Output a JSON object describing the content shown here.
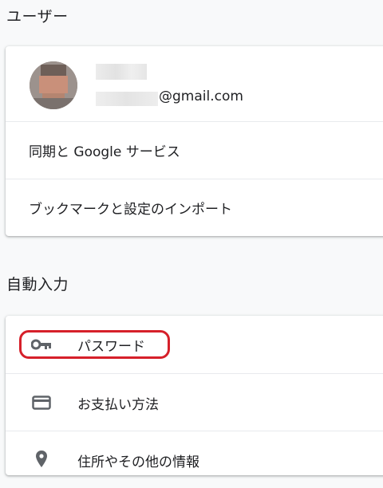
{
  "sections": {
    "user": {
      "title": "ユーザー",
      "account": {
        "email_suffix": "@gmail.com"
      },
      "rows": [
        {
          "label": "同期と Google サービス"
        },
        {
          "label": "ブックマークと設定のインポート"
        }
      ]
    },
    "autofill": {
      "title": "自動入力",
      "rows": [
        {
          "label": "パスワード",
          "icon": "key-icon"
        },
        {
          "label": "お支払い方法",
          "icon": "credit-card-icon"
        },
        {
          "label": "住所やその他の情報",
          "icon": "location-pin-icon"
        }
      ]
    }
  },
  "colors": {
    "background": "#f8f9fa",
    "card": "#ffffff",
    "divider": "#e8eaed",
    "text": "#202124",
    "icon": "#5f6368",
    "highlight": "#d6202a"
  }
}
